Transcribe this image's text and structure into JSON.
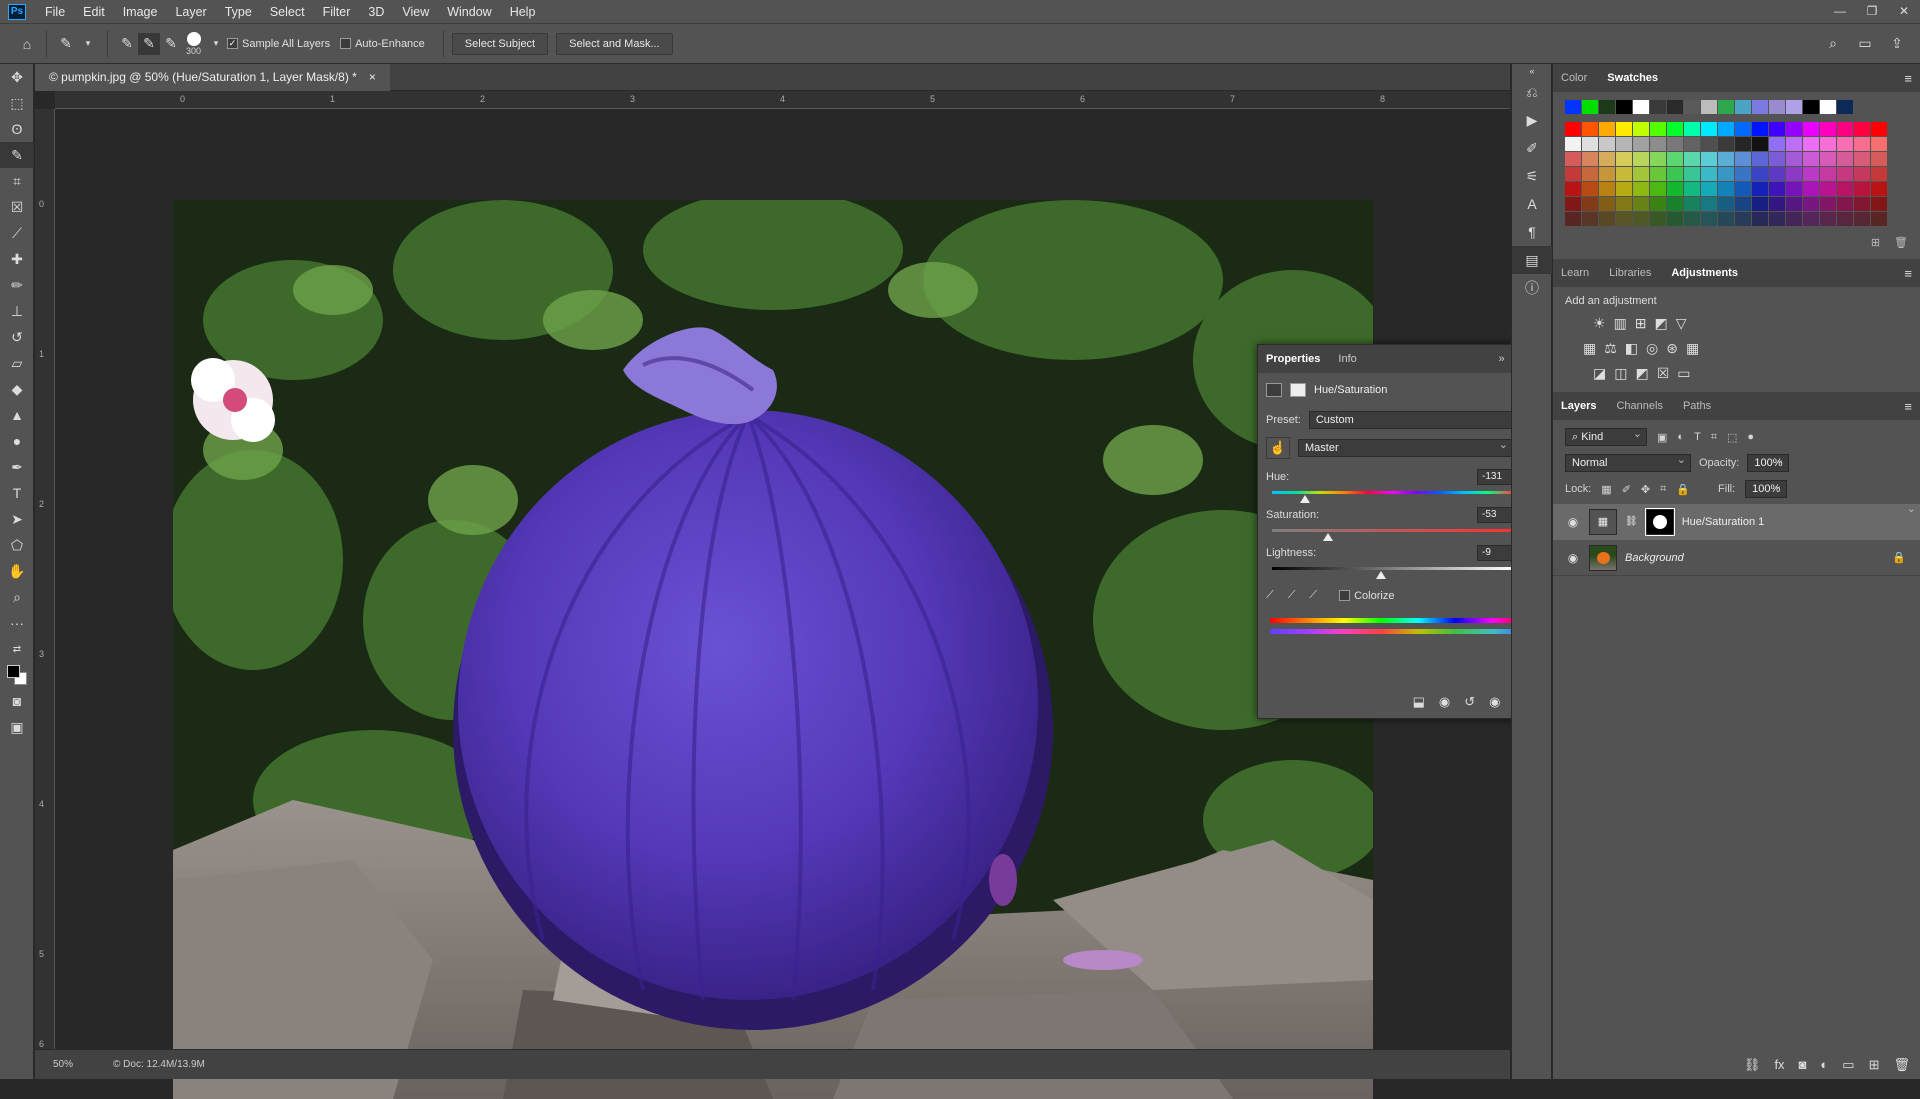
{
  "menu": {
    "logo": "Ps",
    "items": [
      "File",
      "Edit",
      "Image",
      "Layer",
      "Type",
      "Select",
      "Filter",
      "3D",
      "View",
      "Window",
      "Help"
    ],
    "window_controls": [
      "—",
      "❐",
      "✕"
    ]
  },
  "options": {
    "brush_size": "300",
    "sample_all_layers": "Sample All Layers",
    "auto_enhance": "Auto-Enhance",
    "select_subject": "Select Subject",
    "select_and_mask": "Select and Mask..."
  },
  "document": {
    "tab_title": "© pumpkin.jpg @ 50% (Hue/Saturation 1, Layer Mask/8) *",
    "tab_close": "×",
    "zoom": "50%",
    "doc_size": "© Doc: 12.4M/13.9M",
    "ruler_h": [
      "0",
      "1",
      "2",
      "3",
      "4",
      "5",
      "6",
      "7",
      "8"
    ],
    "ruler_v": [
      "0",
      "1",
      "2",
      "3",
      "4",
      "5",
      "6"
    ]
  },
  "properties": {
    "tabs": [
      "Properties",
      "Info"
    ],
    "title": "Hue/Saturation",
    "preset_label": "Preset:",
    "preset_value": "Custom",
    "channel": "Master",
    "hue_label": "Hue:",
    "hue_value": "-131",
    "hue_level": 0.137,
    "saturation_label": "Saturation:",
    "saturation_value": "-53",
    "saturation_level": 0.235,
    "lightness_label": "Lightness:",
    "lightness_value": "-9",
    "lightness_level": 0.455,
    "colorize": "Colorize"
  },
  "swatch_panel": {
    "tabs": [
      "Color",
      "Swatches"
    ],
    "recent": [
      "#0033ff",
      "#00e000",
      "#1a3a1a",
      "#000000",
      "#ffffff",
      "#3a3a3a",
      "#2a2a2a",
      "#5a5a5a",
      "#bcbcbc",
      "#2ea84c",
      "#4ca4c4",
      "#7a7ae0",
      "#9a8ad0",
      "#b0a0e8",
      "#000000",
      "#ffffff",
      "#0b2a5a"
    ]
  },
  "adjustments": {
    "tabs": [
      "Learn",
      "Libraries",
      "Adjustments"
    ],
    "add_label": "Add an adjustment"
  },
  "layers": {
    "tabs": [
      "Layers",
      "Channels",
      "Paths"
    ],
    "kind": "Kind",
    "blend": "Normal",
    "opacity_label": "Opacity:",
    "opacity": "100%",
    "lock_label": "Lock:",
    "fill_label": "Fill:",
    "fill": "100%",
    "items": [
      {
        "name": "Hue/Saturation 1"
      },
      {
        "name": "Background"
      }
    ]
  }
}
